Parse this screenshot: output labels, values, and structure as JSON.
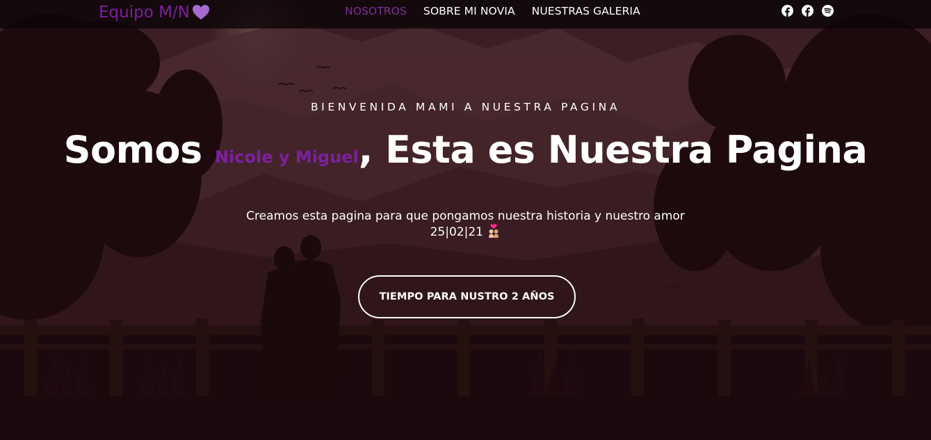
{
  "brand": {
    "name": "Equipo M/N",
    "icon": "purple-heart-icon",
    "color": "#7d1fa0"
  },
  "nav": {
    "items": [
      {
        "label": "NOSOTROS",
        "active": true
      },
      {
        "label": "SOBRE MI NOVIA",
        "active": false
      },
      {
        "label": "NUESTRAS GALERIA",
        "active": false
      }
    ]
  },
  "social": {
    "icons": [
      "facebook-icon",
      "facebook-icon",
      "spotify-icon"
    ]
  },
  "hero": {
    "kicker": "BIENVENIDA MAMI A NUESTRA PAGINA",
    "headline_start": "Somos ",
    "headline_names": "Nicole y Miguel",
    "headline_end": ", Esta es Nuestra Pagina",
    "subtext_line1": "Creamos esta pagina para que pongamos nuestra historia y nuestro amor",
    "subtext_line2": "25|02|21",
    "subtext_icon": "couple-with-heart-icon",
    "cta_label": "TIEMPO PARA NUSTRO 2 AÑOS"
  },
  "colors": {
    "accent": "#7d1fa0",
    "nav_active": "#7d2e9c",
    "background": "#1a0a0e"
  }
}
